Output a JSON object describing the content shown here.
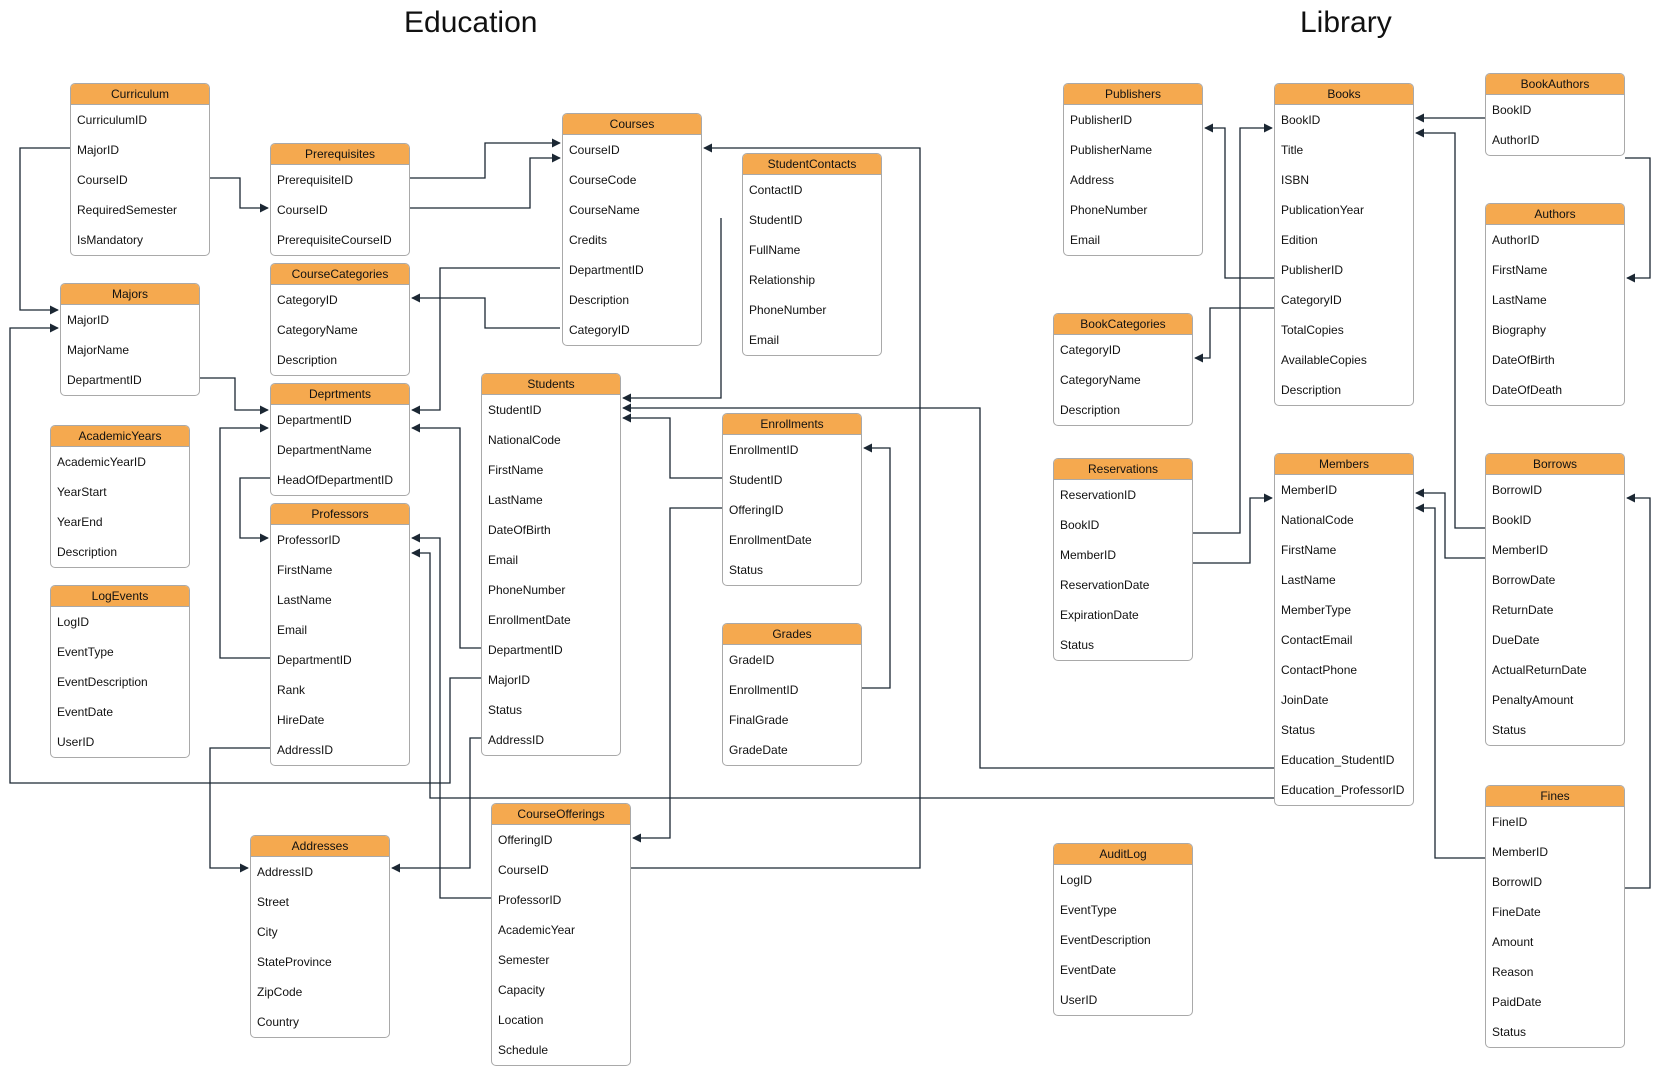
{
  "sections": {
    "education": "Education",
    "library": "Library"
  },
  "colors": {
    "header": "#f5a94f",
    "edge": "#1b2733",
    "border": "#a9a9a9"
  },
  "tables": {
    "curriculum": {
      "title": "Curriculum",
      "fields": [
        "CurriculumID",
        "MajorID",
        "CourseID",
        "RequiredSemester",
        "IsMandatory"
      ]
    },
    "majors": {
      "title": "Majors",
      "fields": [
        "MajorID",
        "MajorName",
        "DepartmentID"
      ]
    },
    "academic_years": {
      "title": "AcademicYears",
      "fields": [
        "AcademicYearID",
        "YearStart",
        "YearEnd",
        "Description"
      ]
    },
    "log_events": {
      "title": "LogEvents",
      "fields": [
        "LogID",
        "EventType",
        "EventDescription",
        "EventDate",
        "UserID"
      ]
    },
    "prerequisites": {
      "title": "Prerequisites",
      "fields": [
        "PrerequisiteID",
        "CourseID",
        "PrerequisiteCourseID"
      ]
    },
    "course_categories": {
      "title": "CourseCategories",
      "fields": [
        "CategoryID",
        "CategoryName",
        "Description"
      ]
    },
    "departments": {
      "title": "Deprtments",
      "fields": [
        "DepartmentID",
        "DepartmentName",
        "HeadOfDepartmentID"
      ]
    },
    "professors": {
      "title": "Professors",
      "fields": [
        "ProfessorID",
        "FirstName",
        "LastName",
        "Email",
        "DepartmentID",
        "Rank",
        "HireDate",
        "AddressID"
      ]
    },
    "addresses": {
      "title": "Addresses",
      "fields": [
        "AddressID",
        "Street",
        "City",
        "StateProvince",
        "ZipCode",
        "Country"
      ]
    },
    "courses": {
      "title": "Courses",
      "fields": [
        "CourseID",
        "CourseCode",
        "CourseName",
        "Credits",
        "DepartmentID",
        "Description",
        "CategoryID"
      ]
    },
    "students": {
      "title": "Students",
      "fields": [
        "StudentID",
        "NationalCode",
        "FirstName",
        "LastName",
        "DateOfBirth",
        "Email",
        "PhoneNumber",
        "EnrollmentDate",
        "DepartmentID",
        "MajorID",
        "Status",
        "AddressID"
      ]
    },
    "course_offerings": {
      "title": "CourseOfferings",
      "fields": [
        "OfferingID",
        "CourseID",
        "ProfessorID",
        "AcademicYear",
        "Semester",
        "Capacity",
        "Location",
        "Schedule"
      ]
    },
    "student_contacts": {
      "title": "StudentContacts",
      "fields": [
        "ContactID",
        "StudentID",
        "FullName",
        "Relationship",
        "PhoneNumber",
        "Email"
      ]
    },
    "enrollments": {
      "title": "Enrollments",
      "fields": [
        "EnrollmentID",
        "StudentID",
        "OfferingID",
        "EnrollmentDate",
        "Status"
      ]
    },
    "grades": {
      "title": "Grades",
      "fields": [
        "GradeID",
        "EnrollmentID",
        "FinalGrade",
        "GradeDate"
      ]
    },
    "publishers": {
      "title": "Publishers",
      "fields": [
        "PublisherID",
        "PublisherName",
        "Address",
        "PhoneNumber",
        "Email"
      ]
    },
    "book_categories": {
      "title": "BookCategories",
      "fields": [
        "CategoryID",
        "CategoryName",
        "Description"
      ]
    },
    "reservations": {
      "title": "Reservations",
      "fields": [
        "ReservationID",
        "BookID",
        "MemberID",
        "ReservationDate",
        "ExpirationDate",
        "Status"
      ]
    },
    "audit_log": {
      "title": "AuditLog",
      "fields": [
        "LogID",
        "EventType",
        "EventDescription",
        "EventDate",
        "UserID"
      ]
    },
    "books": {
      "title": "Books",
      "fields": [
        "BookID",
        "Title",
        "ISBN",
        "PublicationYear",
        "Edition",
        "PublisherID",
        "CategoryID",
        "TotalCopies",
        "AvailableCopies",
        "Description"
      ]
    },
    "members": {
      "title": "Members",
      "fields": [
        "MemberID",
        "NationalCode",
        "FirstName",
        "LastName",
        "MemberType",
        "ContactEmail",
        "ContactPhone",
        "JoinDate",
        "Status",
        "Education_StudentID",
        "Education_ProfessorID"
      ]
    },
    "book_authors": {
      "title": "BookAuthors",
      "fields": [
        "BookID",
        "AuthorID"
      ]
    },
    "authors": {
      "title": "Authors",
      "fields": [
        "AuthorID",
        "FirstName",
        "LastName",
        "Biography",
        "DateOfBirth",
        "DateOfDeath"
      ]
    },
    "borrows": {
      "title": "Borrows",
      "fields": [
        "BorrowID",
        "BookID",
        "MemberID",
        "BorrowDate",
        "ReturnDate",
        "DueDate",
        "ActualReturnDate",
        "PenaltyAmount",
        "Status"
      ]
    },
    "fines": {
      "title": "Fines",
      "fields": [
        "FineID",
        "MemberID",
        "BorrowID",
        "FineDate",
        "Amount",
        "Reason",
        "PaidDate",
        "Status"
      ]
    }
  }
}
